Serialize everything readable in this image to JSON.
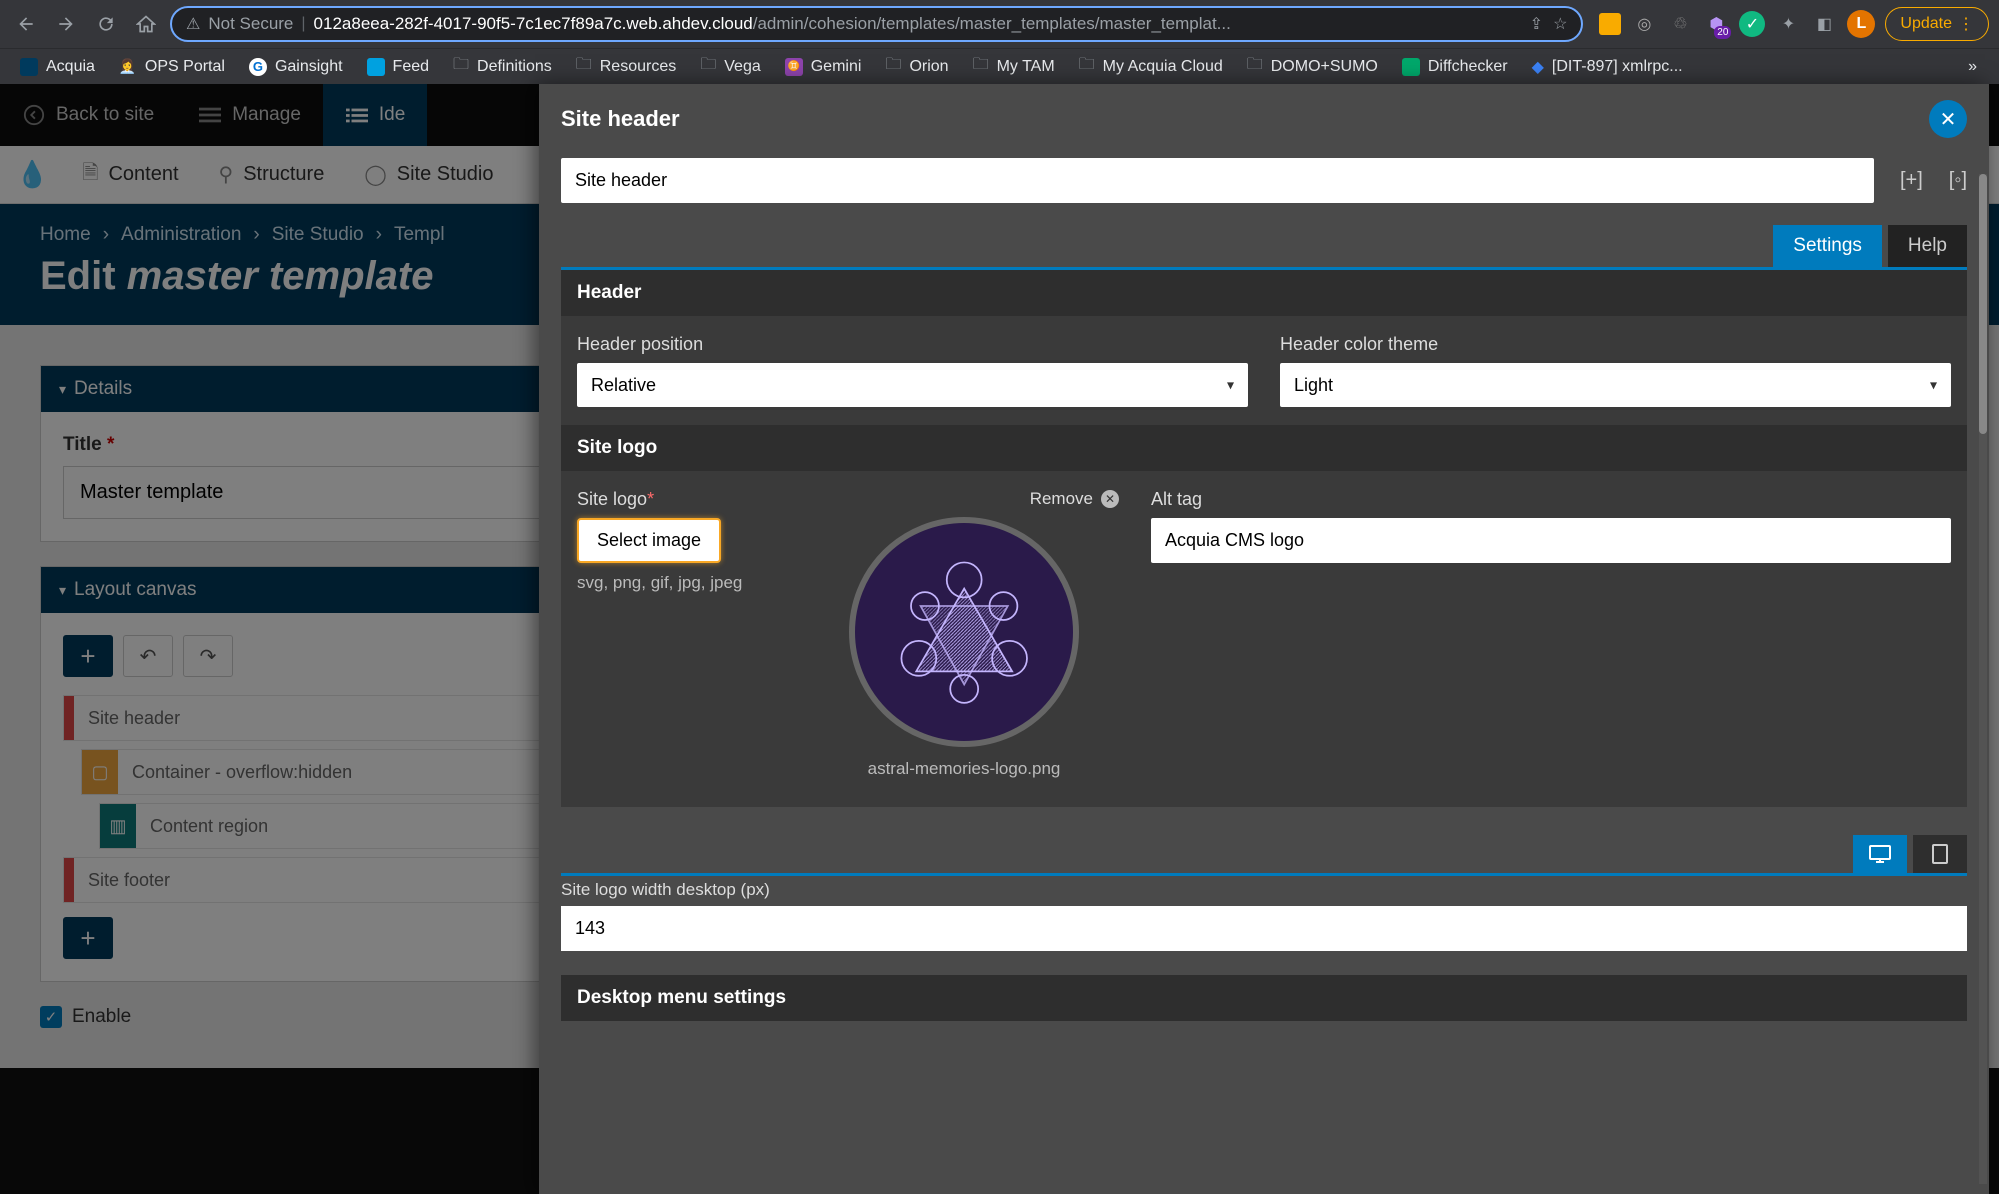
{
  "chrome": {
    "not_secure": "Not Secure",
    "url_host": "012a8eea-282f-4017-90f5-7c1ec7f89a7c.web.ahdev.cloud",
    "url_path": "/admin/cohesion/templates/master_templates/master_templat...",
    "update": "Update",
    "profile_initial": "L",
    "ext_badge": "20"
  },
  "bookmarks": [
    {
      "label": "Acquia"
    },
    {
      "label": "OPS Portal"
    },
    {
      "label": "Gainsight"
    },
    {
      "label": "Feed"
    },
    {
      "label": "Definitions"
    },
    {
      "label": "Resources"
    },
    {
      "label": "Vega"
    },
    {
      "label": "Gemini"
    },
    {
      "label": "Orion"
    },
    {
      "label": "My TAM"
    },
    {
      "label": "My Acquia Cloud"
    },
    {
      "label": "DOMO+SUMO"
    },
    {
      "label": "Diffchecker"
    },
    {
      "label": "[DIT-897] xmlrpc..."
    }
  ],
  "admin_toolbar": {
    "back": "Back to site",
    "manage": "Manage",
    "ide": "Ide"
  },
  "sub_toolbar": {
    "content": "Content",
    "structure": "Structure",
    "site_studio": "Site Studio"
  },
  "breadcrumbs": [
    "Home",
    "Administration",
    "Site Studio",
    "Templ"
  ],
  "page_title_prefix": "Edit ",
  "page_title_em": "master template",
  "panels": {
    "details": "Details",
    "layout_canvas": "Layout canvas"
  },
  "form": {
    "title_label": "Title",
    "title_value": "Master template",
    "enable_label": "Enable"
  },
  "layout_items": {
    "site_header": "Site header",
    "container": "Container - overflow:hidden",
    "content_region": "Content region",
    "site_footer": "Site footer"
  },
  "modal": {
    "title": "Site header",
    "name_value": "Site header",
    "tabs": {
      "settings": "Settings",
      "help": "Help"
    },
    "sections": {
      "header": "Header",
      "site_logo": "Site logo",
      "desktop_menu": "Desktop menu settings"
    },
    "fields": {
      "header_position_label": "Header position",
      "header_position_value": "Relative",
      "header_color_label": "Header color theme",
      "header_color_value": "Light",
      "site_logo_label": "Site logo",
      "select_image": "Select image",
      "file_types": "svg, png, gif, jpg, jpeg",
      "remove": "Remove",
      "logo_filename": "astral-memories-logo.png",
      "alt_tag_label": "Alt tag",
      "alt_tag_value": "Acquia CMS logo",
      "width_label": "Site logo width desktop (px)",
      "width_value": "143"
    }
  }
}
